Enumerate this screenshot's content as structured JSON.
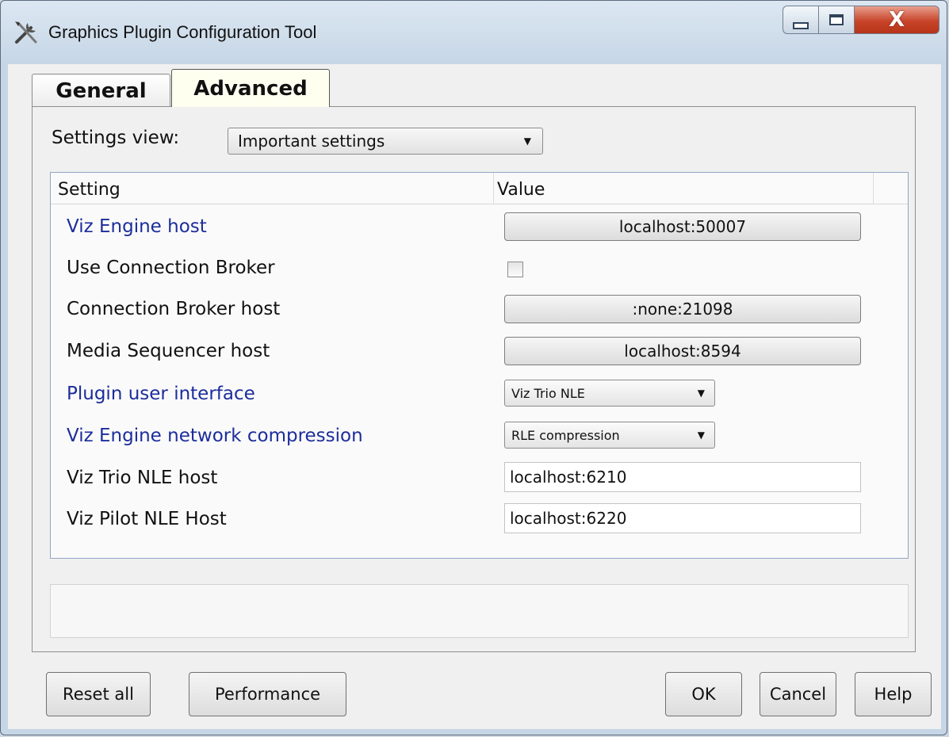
{
  "window": {
    "title": "Graphics Plugin Configuration Tool",
    "close_glyph": "X",
    "icon": "tools-icon"
  },
  "tabs": [
    {
      "label": "General",
      "selected": false
    },
    {
      "label": "Advanced",
      "selected": true
    }
  ],
  "settings_view": {
    "label": "Settings view:",
    "selected": "Important settings"
  },
  "grid": {
    "columns": [
      "Setting",
      "Value"
    ],
    "rows": [
      {
        "label": "Viz Engine host",
        "highlight": true,
        "type": "button",
        "value": "localhost:50007"
      },
      {
        "label": "Use Connection Broker",
        "highlight": false,
        "type": "checkbox",
        "checked": false
      },
      {
        "label": "Connection Broker host",
        "highlight": false,
        "type": "button",
        "value": ":none:21098"
      },
      {
        "label": "Media Sequencer host",
        "highlight": false,
        "type": "button",
        "value": "localhost:8594"
      },
      {
        "label": "Plugin user interface",
        "highlight": true,
        "type": "select",
        "value": "Viz Trio NLE"
      },
      {
        "label": "Viz Engine network compression",
        "highlight": true,
        "type": "select",
        "value": "RLE compression"
      },
      {
        "label": "Viz Trio NLE host",
        "highlight": false,
        "type": "input",
        "value": "localhost:6210"
      },
      {
        "label": "Viz Pilot NLE Host",
        "highlight": false,
        "type": "input",
        "value": "localhost:6220"
      }
    ]
  },
  "buttons": {
    "reset_all": "Reset all",
    "performance": "Performance",
    "ok": "OK",
    "cancel": "Cancel",
    "help": "Help"
  },
  "colors": {
    "highlight_label": "#1c2d9c",
    "close_button": "#c7442a"
  }
}
